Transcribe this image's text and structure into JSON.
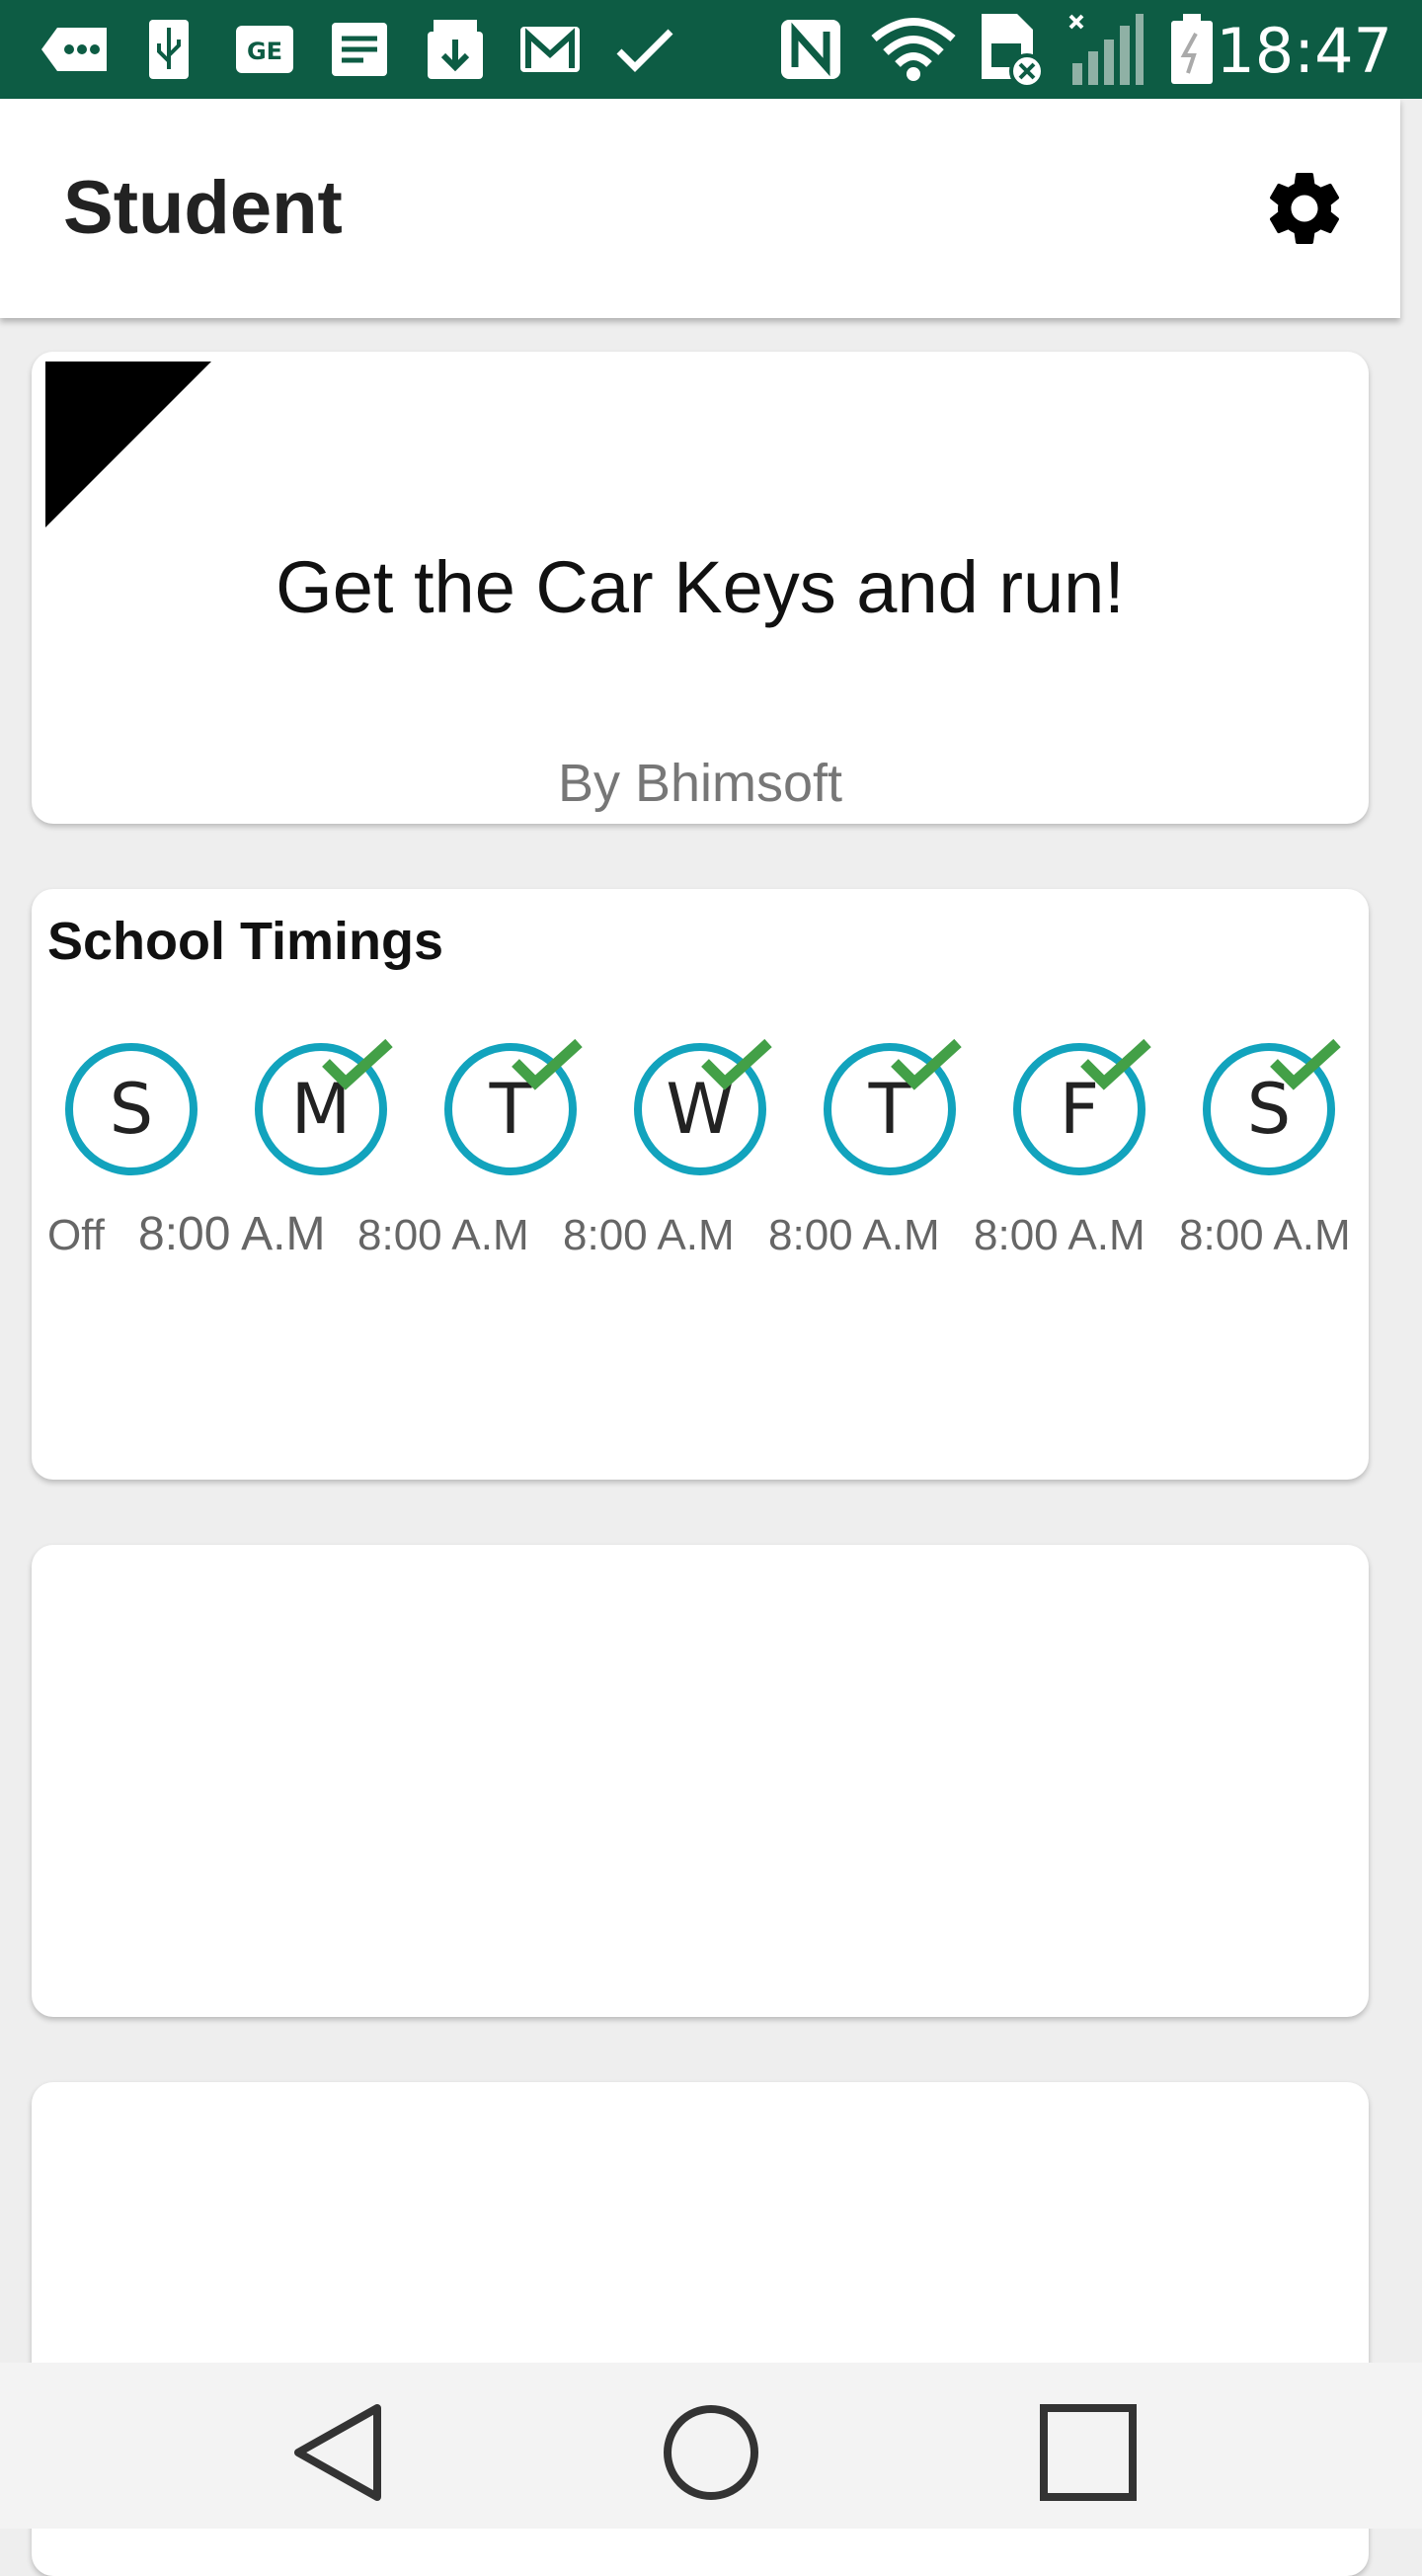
{
  "status_bar": {
    "time": "18:47",
    "background": "#0d5c44",
    "icons": [
      "more-messages-icon",
      "usb-icon",
      "ge-icon",
      "notes-icon",
      "download-icon",
      "gmail-icon",
      "check-icon",
      "nfc-icon",
      "wifi-icon",
      "sim-blocked-icon",
      "signal-icon",
      "battery-charging-icon"
    ]
  },
  "app_bar": {
    "title": "Student",
    "settings_icon": "gear-icon"
  },
  "quote_card": {
    "text": "Get the Car Keys and run!",
    "author": "By Bhimsoft"
  },
  "school_timings": {
    "title": "School Timings",
    "accent": "#12a3bd",
    "check_color": "#43a047",
    "days": [
      {
        "letter": "S",
        "time": "Off",
        "checked": false
      },
      {
        "letter": "M",
        "time": "8:00 A.M",
        "checked": true
      },
      {
        "letter": "T",
        "time": "8:00 A.M",
        "checked": true
      },
      {
        "letter": "W",
        "time": "8:00 A.M",
        "checked": true
      },
      {
        "letter": "T",
        "time": "8:00 A.M",
        "checked": true
      },
      {
        "letter": "F",
        "time": "8:00 A.M",
        "checked": true
      },
      {
        "letter": "S",
        "time": "8:00 A.M",
        "checked": true
      }
    ]
  },
  "nav_bar": {
    "back": "back-triangle-icon",
    "home": "home-circle-icon",
    "recents": "recents-square-icon"
  }
}
